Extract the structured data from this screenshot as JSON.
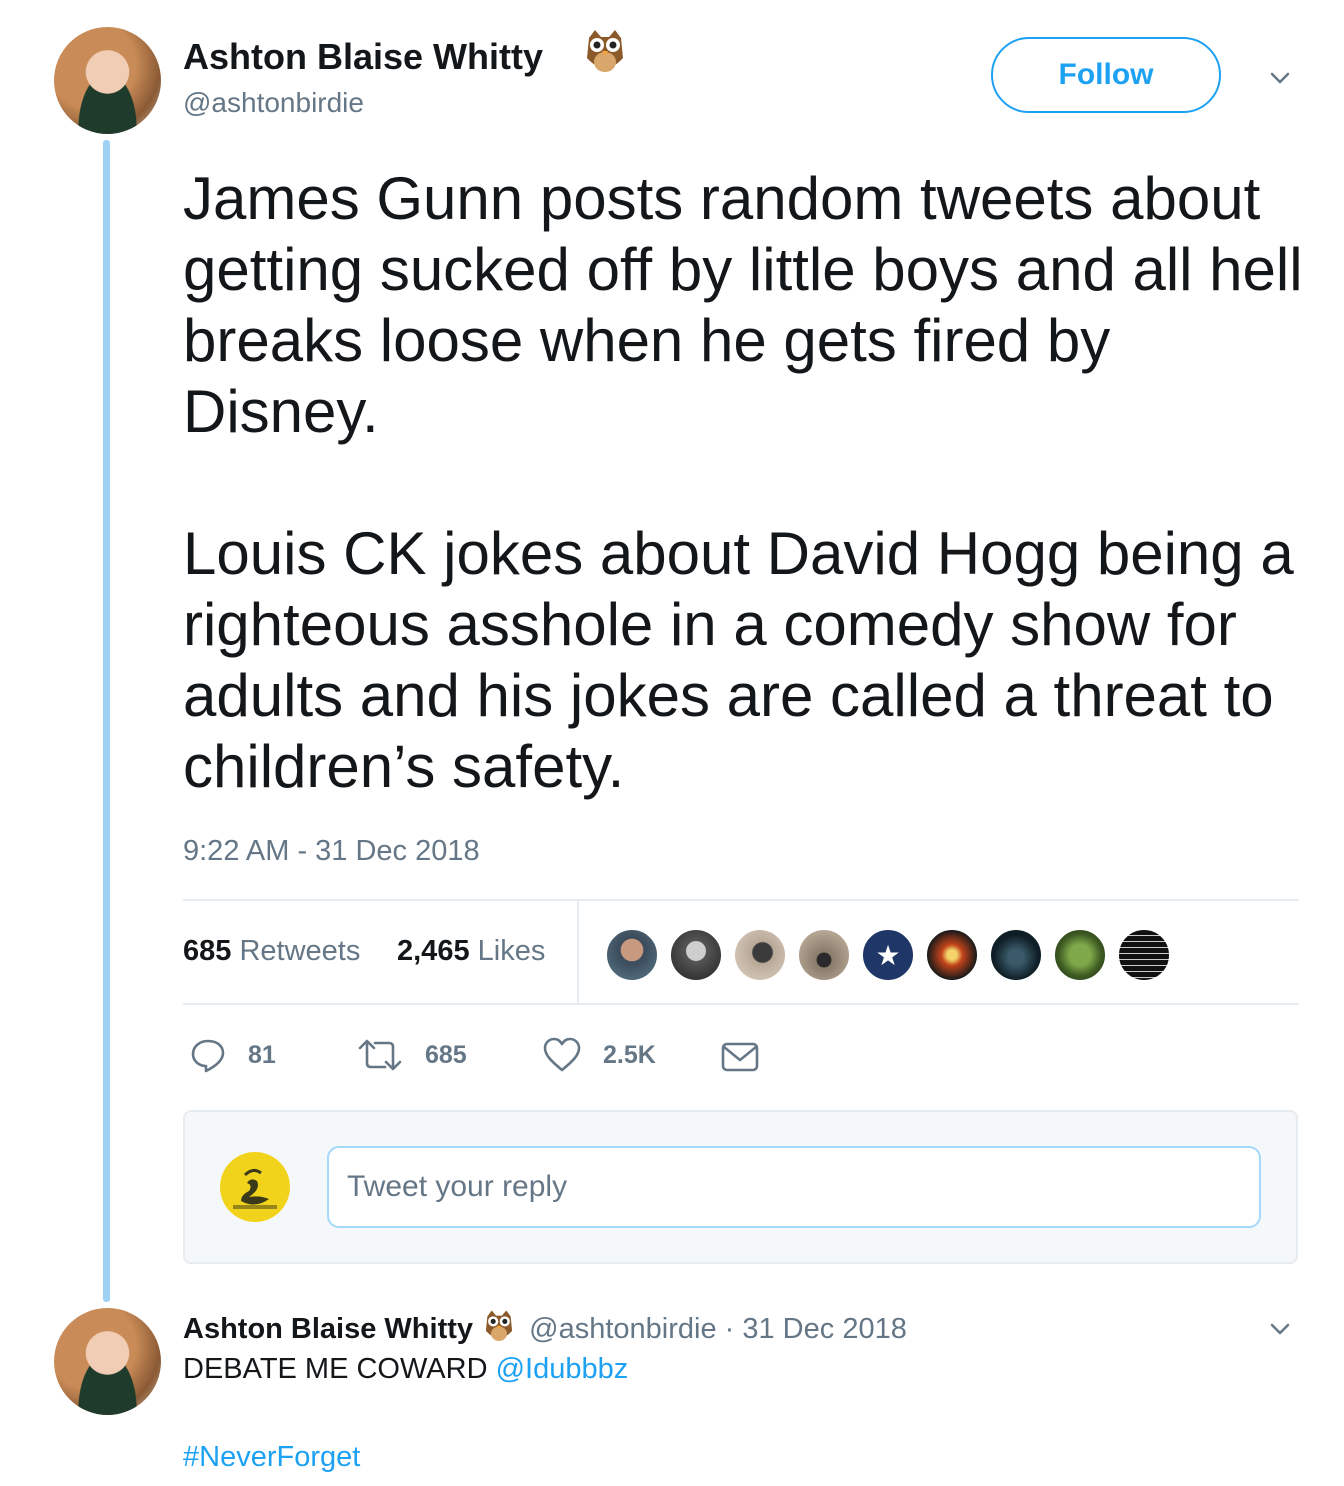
{
  "main_tweet": {
    "author": {
      "name": "Ashton Blaise Whitty",
      "handle": "@ashtonbirdie",
      "badge_icon": "owl-emoji"
    },
    "follow_label": "Follow",
    "text": "James Gunn posts random tweets about getting sucked off by little boys and all hell breaks loose when he gets fired by Disney.\n\nLouis CK jokes about David Hogg being a righteous asshole in a comedy show for adults and his jokes are called a threat to children’s safety.",
    "timestamp": "9:22 AM - 31 Dec 2018",
    "stats": {
      "retweets_count": "685",
      "retweets_label": "Retweets",
      "likes_count": "2,465",
      "likes_label": "Likes"
    },
    "likers_icons": [
      "liker-avatar",
      "liker-avatar",
      "liker-avatar",
      "liker-avatar",
      "star-avatar",
      "liker-avatar",
      "liker-avatar",
      "liker-avatar",
      "text-avatar"
    ],
    "actions": {
      "replies": "81",
      "retweets": "685",
      "likes": "2.5K"
    }
  },
  "reply_composer": {
    "placeholder": "Tweet your reply",
    "avatar_icon": "gadsden-flag-avatar"
  },
  "thread_reply": {
    "author": {
      "name": "Ashton Blaise Whitty",
      "handle": "@ashtonbirdie",
      "badge_icon": "owl-emoji"
    },
    "date": "· 31 Dec 2018",
    "text_prefix": "DEBATE ME COWARD ",
    "mention": "@Idubbbz",
    "hashtag": "#NeverForget"
  },
  "colors": {
    "accent": "#1da1f2",
    "muted": "#657786",
    "thread_line": "#9fd0f5",
    "text": "#14171a"
  }
}
